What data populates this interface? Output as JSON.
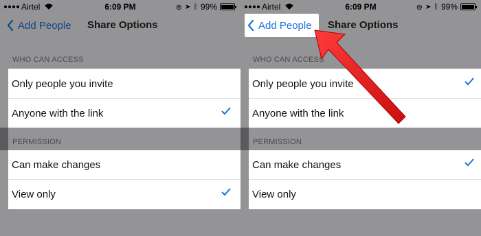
{
  "panels": [
    {
      "status": {
        "carrier": "Airtel",
        "time": "6:09 PM",
        "battery": "99%",
        "battery_level": 0.99
      },
      "nav": {
        "back_label": "Add People",
        "title": "Share Options"
      },
      "access": {
        "header": "WHO CAN ACCESS",
        "items": [
          {
            "label": "Only people you invite",
            "checked": false
          },
          {
            "label": "Anyone with the link",
            "checked": true
          }
        ]
      },
      "permission": {
        "header": "PERMISSION",
        "items": [
          {
            "label": "Can make changes",
            "checked": false
          },
          {
            "label": "View only",
            "checked": true
          }
        ]
      }
    },
    {
      "status": {
        "carrier": "Airtel",
        "time": "6:09 PM",
        "battery": "99%",
        "battery_level": 0.99
      },
      "nav": {
        "back_label": "Add People",
        "title": "Share Options"
      },
      "access": {
        "header": "WHO CAN ACCESS",
        "items": [
          {
            "label": "Only people you invite",
            "checked": true
          },
          {
            "label": "Anyone with the link",
            "checked": false
          }
        ]
      },
      "permission": {
        "header": "PERMISSION",
        "items": [
          {
            "label": "Can make changes",
            "checked": true
          },
          {
            "label": "View only",
            "checked": false
          }
        ]
      }
    }
  ],
  "colors": {
    "accent": "#1a73d8",
    "arrow": "#e01b1b",
    "overlay": "rgba(0,0,0,0.38)"
  }
}
